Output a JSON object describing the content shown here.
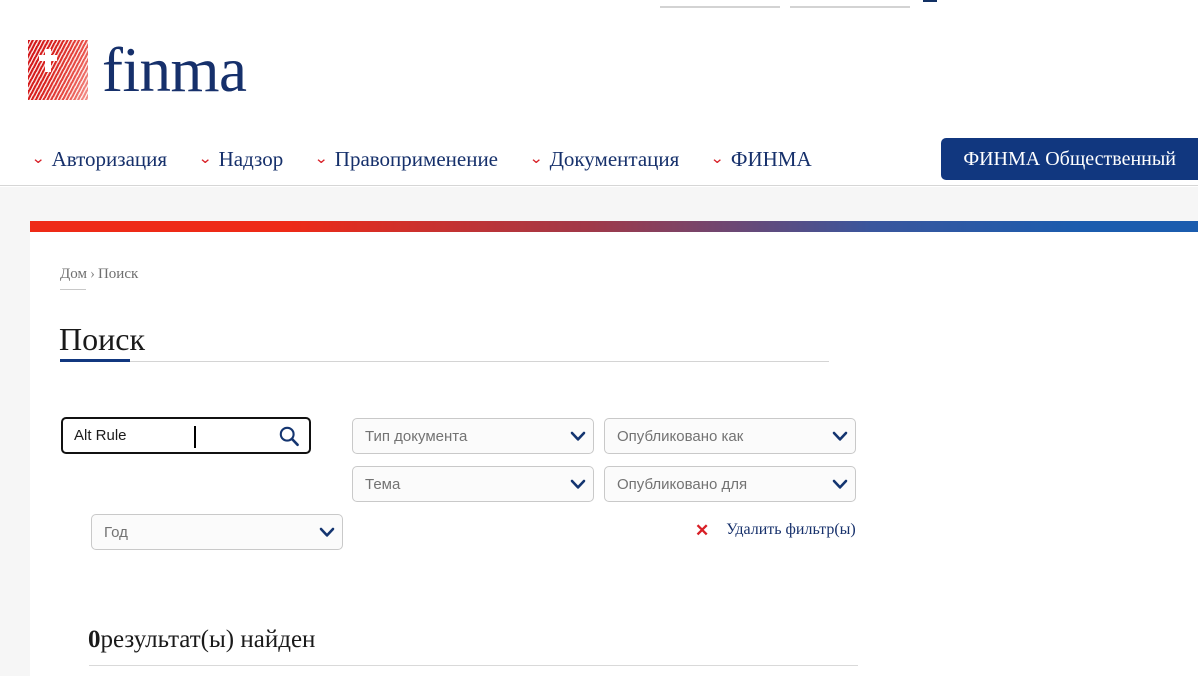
{
  "brand": {
    "logo_word": "finma",
    "logo_mark_name": "swiss-cross-flag"
  },
  "nav": {
    "items": [
      {
        "label": "Авторизация",
        "icon": "chevron-down-icon"
      },
      {
        "label": "Надзор",
        "icon": "chevron-down-icon"
      },
      {
        "label": "Правоприменение",
        "icon": "chevron-down-icon"
      },
      {
        "label": "Документация",
        "icon": "chevron-down-icon"
      },
      {
        "label": "ФИНМА",
        "icon": "chevron-down-icon"
      }
    ],
    "public_button": "ФИНМА Общественный"
  },
  "breadcrumb": {
    "home": "Дом",
    "separator": "›",
    "current": "Поиск"
  },
  "page": {
    "title": "Поиск"
  },
  "search": {
    "value": "Alt Rule",
    "icon": "search-icon"
  },
  "filters": {
    "document_type": "Тип документа",
    "published_as": "Опубликовано как",
    "topic": "Тема",
    "published_for": "Опубликовано для",
    "year": "Год",
    "clear": {
      "icon": "close-x-icon",
      "mark": "✕",
      "label": "Удалить фильтр(ы)"
    }
  },
  "results": {
    "count": "0",
    "label": "результат(ы) найден"
  },
  "colors": {
    "brand_navy": "#16306b",
    "brand_red": "#d81f26",
    "gradient_start": "#ee2a17",
    "gradient_end": "#1b5cae",
    "button_navy": "#11377f",
    "grey_band": "#f6f6f6"
  }
}
